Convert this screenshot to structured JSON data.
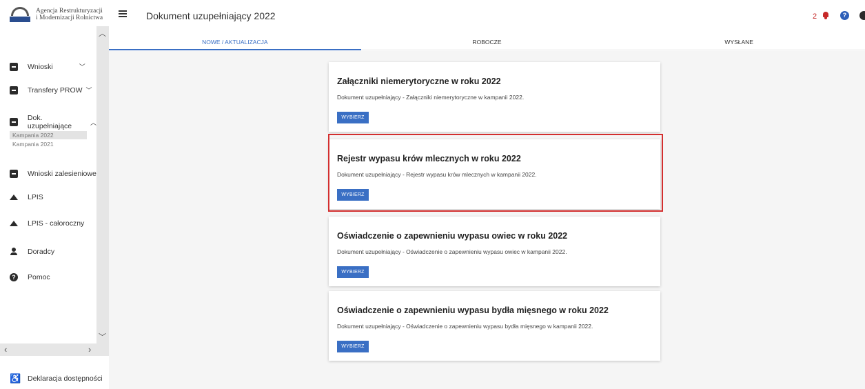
{
  "logo": {
    "line1": "Agencja Restrukturyzacji",
    "line2": "i Modernizacji Rolnictwa"
  },
  "header": {
    "title": "Dokument uzupełniający 2022",
    "notification_count": "2"
  },
  "tabs": [
    {
      "label": "NOWE / AKTUALIZACJA",
      "active": true
    },
    {
      "label": "ROBOCZE"
    },
    {
      "label": "WYSŁANE"
    }
  ],
  "sidebar": {
    "items": [
      {
        "label": "Wnioski",
        "icon": "document-icon"
      },
      {
        "label": "Transfery PROW",
        "icon": "document-icon"
      },
      {
        "label": "Dok. uzupełniające",
        "icon": "document-icon"
      },
      {
        "label": "Wnioski zalesieniowe",
        "icon": "document-icon"
      },
      {
        "label": "LPIS",
        "icon": "mountain-icon"
      },
      {
        "label": "LPIS - całoroczny",
        "icon": "mountain-icon"
      },
      {
        "label": "Doradcy",
        "icon": "person-icon"
      },
      {
        "label": "Pomoc",
        "icon": "help-icon"
      }
    ],
    "sub_items": [
      {
        "label": "Kampania 2022",
        "active": true
      },
      {
        "label": "Kampania 2021"
      }
    ],
    "footer_label": "Deklaracja dostępności"
  },
  "cards": [
    {
      "title": "Załączniki niemerytoryczne w roku 2022",
      "description": "Dokument uzupełniający - Załączniki niemerytoryczne w kampanii 2022.",
      "button": "WYBIERZ"
    },
    {
      "title": "Rejestr wypasu krów mlecznych w roku 2022",
      "description": "Dokument uzupełniający - Rejestr wypasu krów mlecznych w kampanii 2022.",
      "button": "WYBIERZ"
    },
    {
      "title": "Oświadczenie o zapewnieniu wypasu owiec w roku 2022",
      "description": "Dokument uzupełniający - Oświadczenie o zapewnieniu wypasu owiec w kampanii 2022.",
      "button": "WYBIERZ"
    },
    {
      "title": "Oświadczenie o zapewnieniu wypasu bydła mięsnego w roku 2022",
      "description": "Dokument uzupełniający - Oświadczenie o zapewnieniu wypasu bydła mięsnego w kampanii 2022.",
      "button": "WYBIERZ"
    }
  ],
  "colors": {
    "accent": "#3a6fc4",
    "highlight": "#d32f2f",
    "notification": "#c62828"
  }
}
